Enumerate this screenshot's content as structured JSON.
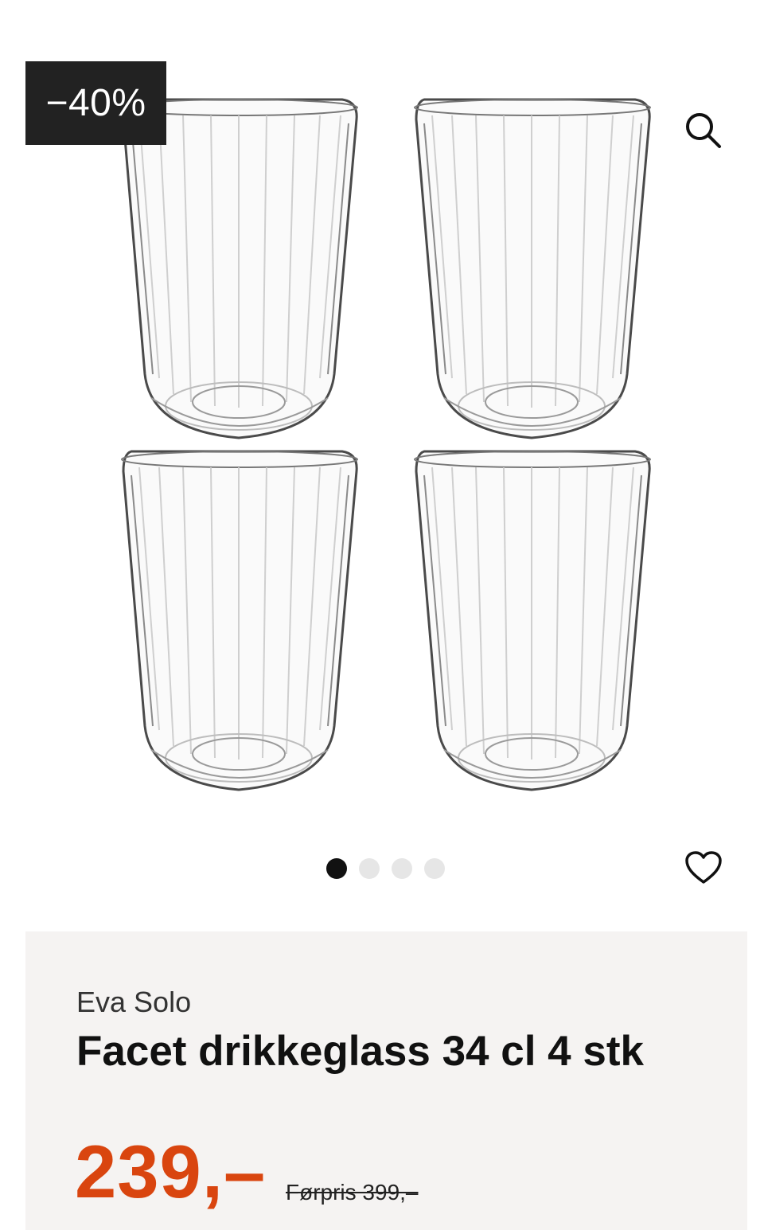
{
  "gallery": {
    "discount_badge": "−40%",
    "image_icon": "product-glasses-image",
    "zoom_icon": "search-icon",
    "favorite_icon": "heart-icon",
    "carousel": {
      "count": 4,
      "active_index": 0
    }
  },
  "product": {
    "brand": "Eva Solo",
    "title": "Facet drikkeglass 34 cl 4 stk",
    "price": "239,–",
    "previous_price": "Førpris 399,–"
  },
  "colors": {
    "price": "#d9450f",
    "badge_bg": "#222222",
    "info_bg": "#f5f3f2",
    "dot_active": "#111111",
    "dot_inactive": "#e6e6e6"
  }
}
